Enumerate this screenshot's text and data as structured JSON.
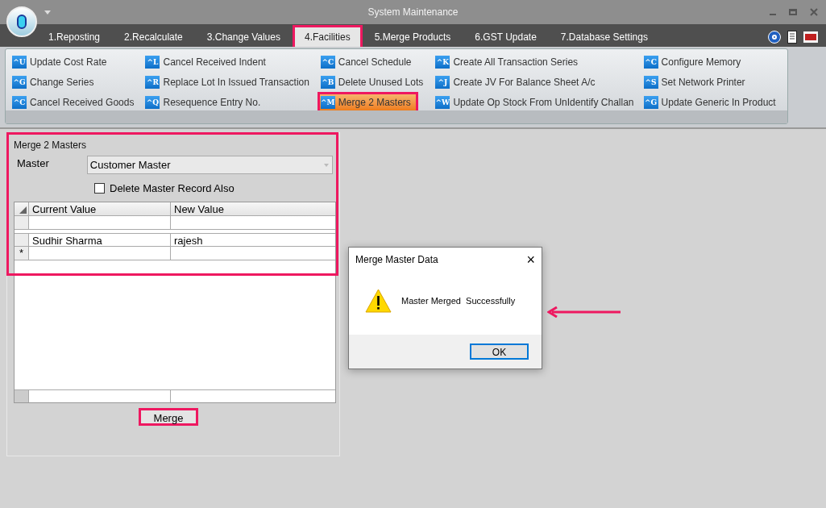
{
  "window": {
    "title": "System Maintenance"
  },
  "tabs": [
    {
      "label": "1.Reposting",
      "selected": false,
      "highlighted": false
    },
    {
      "label": "2.Recalculate",
      "selected": false,
      "highlighted": false
    },
    {
      "label": "3.Change Values",
      "selected": false,
      "highlighted": false
    },
    {
      "label": "4.Facilities",
      "selected": true,
      "highlighted": true
    },
    {
      "label": "5.Merge Products",
      "selected": false,
      "highlighted": false
    },
    {
      "label": "6.GST Update",
      "selected": false,
      "highlighted": false
    },
    {
      "label": "7.Database Settings",
      "selected": false,
      "highlighted": false
    }
  ],
  "ribbon": {
    "columns": [
      [
        {
          "icon": "^U",
          "label": "Update Cost Rate",
          "selected": false
        },
        {
          "icon": "^G",
          "label": "Change Series",
          "selected": false
        },
        {
          "icon": "^C",
          "label": "Cancel Received Goods",
          "selected": false
        }
      ],
      [
        {
          "icon": "^L",
          "label": "Cancel Received Indent",
          "selected": false
        },
        {
          "icon": "^R",
          "label": "Replace Lot In Issued Transaction",
          "selected": false
        },
        {
          "icon": "^Q",
          "label": "Resequence Entry No.",
          "selected": false
        }
      ],
      [
        {
          "icon": "^C",
          "label": "Cancel Schedule",
          "selected": false
        },
        {
          "icon": "^B",
          "label": "Delete Unused Lots",
          "selected": false
        },
        {
          "icon": "^M",
          "label": "Merge 2 Masters",
          "selected": true
        }
      ],
      [
        {
          "icon": "^K",
          "label": "Create All Transaction Series",
          "selected": false
        },
        {
          "icon": "^J",
          "label": "Create JV For Balance Sheet A/c",
          "selected": false
        },
        {
          "icon": "^W",
          "label": "Update Op Stock From UnIdentify Challan",
          "selected": false
        }
      ],
      [
        {
          "icon": "^C",
          "label": "Configure Memory",
          "selected": false
        },
        {
          "icon": "^S",
          "label": "Set Network Printer",
          "selected": false
        },
        {
          "icon": "^G",
          "label": "Update Generic In Product",
          "selected": false
        }
      ]
    ]
  },
  "form": {
    "title": "Merge 2 Masters",
    "highlighted": true,
    "master_label": "Master",
    "master_value": "Customer Master",
    "delete_checkbox": {
      "label": "Delete Master Record Also",
      "checked": false
    },
    "table": {
      "columns": [
        "Current Value",
        "New Value"
      ],
      "rows": [
        {
          "cells": [
            "",
            ""
          ],
          "new_row": false
        },
        {
          "cells": [
            "Sudhir Sharma",
            "rajesh"
          ],
          "new_row": false
        },
        {
          "cells": [
            "",
            ""
          ],
          "new_row": true
        }
      ],
      "new_row_marker": "*"
    },
    "merge_button": {
      "label": "Merge",
      "highlighted": true
    }
  },
  "dialog": {
    "title": "Merge Master Data",
    "close": "×",
    "message": "Master Merged  Successfully",
    "ok": "OK",
    "pointed_at": true
  }
}
